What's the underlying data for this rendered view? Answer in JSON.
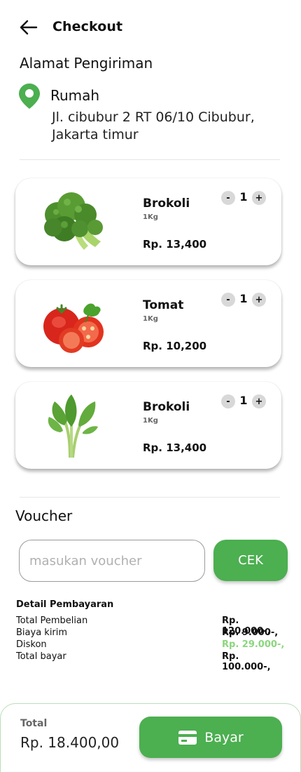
{
  "header": {
    "title": "Checkout"
  },
  "address": {
    "heading": "Alamat Pengiriman",
    "name": "Rumah",
    "line": "Jl. cibubur 2 RT 06/10 Cibubur, Jakarta timur"
  },
  "cart": {
    "items": [
      {
        "name": "Brokoli",
        "weight": "1Kg",
        "price": "Rp. 13,400",
        "qty": "1",
        "minus": "-",
        "plus": "+",
        "image": "broccoli-image"
      },
      {
        "name": "Tomat",
        "weight": "1Kg",
        "price": "Rp. 10,200",
        "qty": "1",
        "minus": "-",
        "plus": "+",
        "image": "tomato-image"
      },
      {
        "name": "Brokoli",
        "weight": "1Kg",
        "price": "Rp. 13,400",
        "qty": "1",
        "minus": "-",
        "plus": "+",
        "image": "leafy-greens-image"
      }
    ]
  },
  "voucher": {
    "heading": "Voucher",
    "placeholder": "masukan voucher",
    "button": "CEK"
  },
  "payment": {
    "heading": "Detail Pembayaran",
    "rows": [
      {
        "label": "Total Pembelian",
        "value": "Rp. 120.000-,"
      },
      {
        "label": "Biaya kirim",
        "value": "Rp. 9.000-,"
      },
      {
        "label": "Diskon",
        "value": "Rp. 29.000-,",
        "color": "#8bd67e"
      },
      {
        "label": "Total bayar",
        "value": "Rp. 100.000-,"
      }
    ]
  },
  "footer": {
    "total_label": "Total",
    "total_value": "Rp. 18.400,00",
    "button": "Bayar"
  },
  "colors": {
    "primary": "#4caf50",
    "discount": "#8bd67e",
    "location_pin": "#4caf50"
  }
}
